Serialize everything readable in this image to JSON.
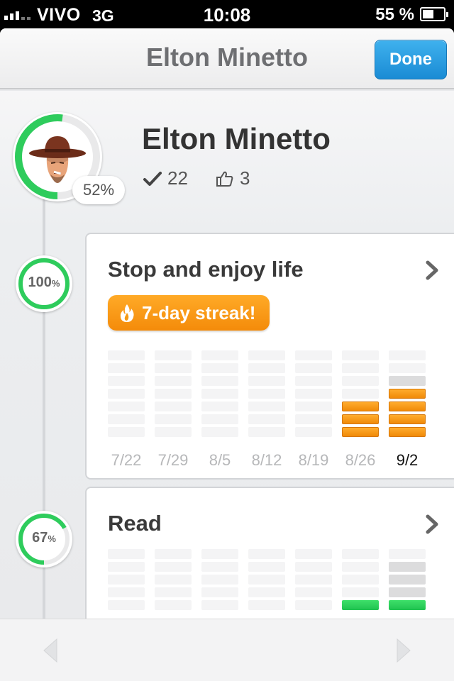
{
  "status_bar": {
    "carrier": "VIVO",
    "network": "3G",
    "time": "10:08",
    "battery": "55 %",
    "battery_level": 0.55
  },
  "navbar": {
    "title": "Elton Minetto",
    "done_label": "Done"
  },
  "profile": {
    "name": "Elton Minetto",
    "progress": 0.52,
    "progress_label": "52%",
    "checks": "22",
    "likes": "3",
    "avatar_icon": "cowboy-avatar"
  },
  "colors": {
    "accent_green": "#2ecc5c",
    "streak_orange": "#f59a14",
    "done_blue": "#1f95dc"
  },
  "habits": [
    {
      "title": "Stop and enjoy life",
      "percent": 1.0,
      "percent_value": "100",
      "percent_unit": "%",
      "streak_label": "7-day streak!",
      "bar_color": "orange",
      "weeks": [
        {
          "label": "7/22",
          "count": 0,
          "current": false
        },
        {
          "label": "7/29",
          "count": 0,
          "current": false
        },
        {
          "label": "8/5",
          "count": 0,
          "current": false
        },
        {
          "label": "8/12",
          "count": 0,
          "current": false
        },
        {
          "label": "8/19",
          "count": 0,
          "current": false
        },
        {
          "label": "8/26",
          "count": 3,
          "current": false
        },
        {
          "label": "9/2",
          "count": 4,
          "current": true
        }
      ]
    },
    {
      "title": "Read",
      "percent": 0.67,
      "percent_value": "67",
      "percent_unit": "%",
      "bar_color": "green",
      "weeks": [
        {
          "count": 0
        },
        {
          "count": 0
        },
        {
          "count": 0
        },
        {
          "count": 0
        },
        {
          "count": 0
        },
        {
          "count": 1
        },
        {
          "count": 1
        }
      ]
    }
  ]
}
